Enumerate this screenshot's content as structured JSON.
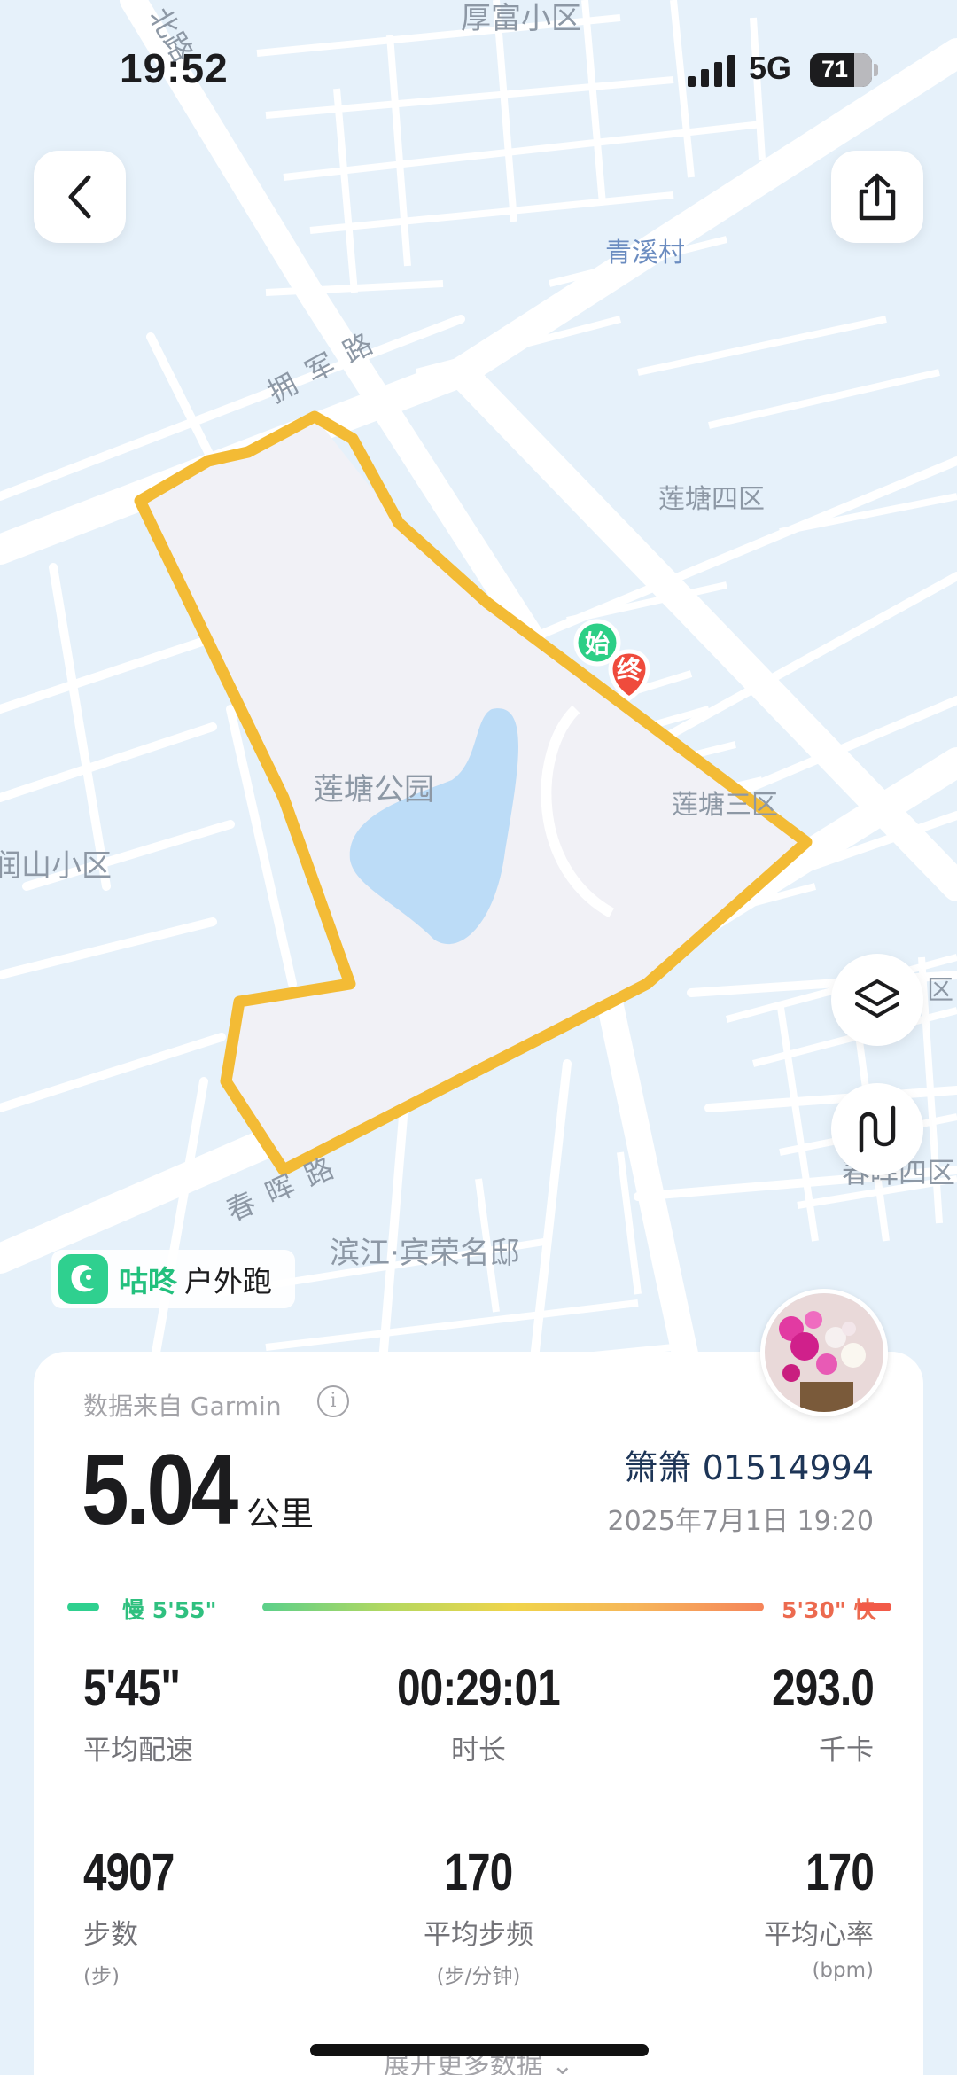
{
  "status_bar": {
    "time": "19:52",
    "network": "5G",
    "battery": "71"
  },
  "map": {
    "labels": {
      "north_road": "北路",
      "houfu": "厚富小区",
      "qingxi": "青溪村",
      "yongjun": "拥军路",
      "liantang4": "莲塘四区",
      "park": "莲塘公园",
      "liantang3": "莲塘三区",
      "runshan": "润山小区",
      "qu": "区",
      "chunhui_road": "春晖路",
      "chunhui4": "春晖四区",
      "binjiang": "滨江·宾荣名邸"
    },
    "start_marker": "始",
    "end_marker": "终",
    "colors": {
      "route": "#f3bb35",
      "park": "#f0f0f5",
      "water": "#bcdcf7",
      "land": "#e6f1fa",
      "road": "#ffffff"
    }
  },
  "buttons": {
    "back_icon": "chevron-left-icon",
    "share_icon": "share-icon",
    "layers_icon": "layers-icon",
    "route_icon": "route-icon"
  },
  "brand": {
    "name": "咕咚",
    "activity": "户外跑"
  },
  "summary": {
    "source": "数据来自 Garmin",
    "distance": "5.04",
    "distance_unit": "公里",
    "user": "箫箫 01514994",
    "datetime": "2025年7月1日 19:20"
  },
  "pace": {
    "slow_label": "慢 5'55\"",
    "fast_label": "5'30\" 快"
  },
  "stats": [
    {
      "value": "5'45\"",
      "label": "平均配速",
      "sub": ""
    },
    {
      "value": "00:29:01",
      "label": "时长",
      "sub": ""
    },
    {
      "value": "293.0",
      "label": "千卡",
      "sub": ""
    },
    {
      "value": "4907",
      "label": "步数",
      "sub": "(步)"
    },
    {
      "value": "170",
      "label": "平均步频",
      "sub": "(步/分钟)"
    },
    {
      "value": "170",
      "label": "平均心率",
      "sub": "(bpm)"
    }
  ],
  "expand_label": "展开更多数据"
}
